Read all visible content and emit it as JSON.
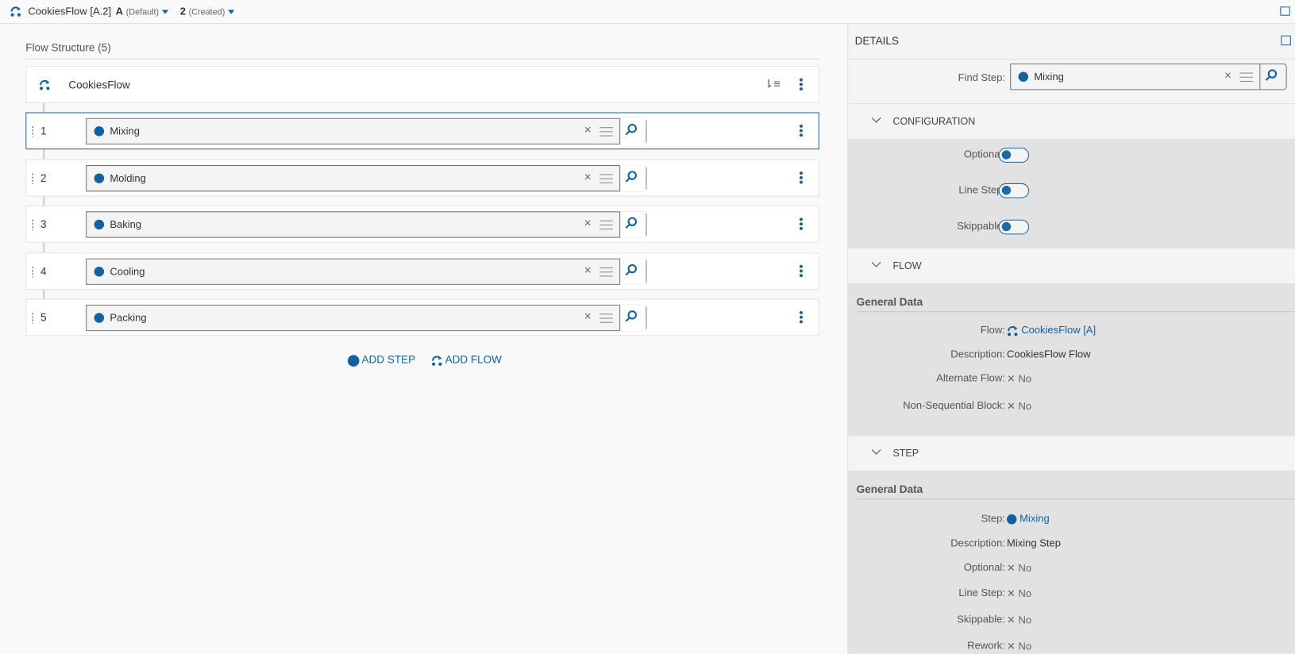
{
  "topbar": {
    "title": "CookiesFlow [A.2]",
    "version": "A",
    "version_note": "(Default)",
    "revision": "2",
    "revision_note": "(Created)"
  },
  "structure": {
    "title": "Flow Structure (5)",
    "root": "CookiesFlow",
    "steps": [
      {
        "num": "1",
        "name": "Mixing"
      },
      {
        "num": "2",
        "name": "Molding"
      },
      {
        "num": "3",
        "name": "Baking"
      },
      {
        "num": "4",
        "name": "Cooling"
      },
      {
        "num": "5",
        "name": "Packing"
      }
    ],
    "add_step": "ADD STEP",
    "add_flow": "ADD FLOW"
  },
  "details": {
    "title": "DETAILS",
    "find_label": "Find Step:",
    "find_value": "Mixing",
    "configuration": {
      "title": "CONFIGURATION",
      "optional": "Optional:",
      "line_step": "Line Step:",
      "skippable": "Skippable:"
    },
    "flow": {
      "title": "FLOW",
      "general": "General Data",
      "flow_label": "Flow:",
      "flow_value": "CookiesFlow [A]",
      "desc_label": "Description:",
      "desc_value": "CookiesFlow Flow",
      "alt_label": "Alternate Flow:",
      "alt_value": "No",
      "nsb_label": "Non-Sequential Block:",
      "nsb_value": "No"
    },
    "step": {
      "title": "STEP",
      "general": "General Data",
      "step_label": "Step:",
      "step_value": "Mixing",
      "desc_label": "Description:",
      "desc_value": "Mixing Step",
      "optional_label": "Optional:",
      "optional_value": "No",
      "line_label": "Line Step:",
      "line_value": "No",
      "skip_label": "Skippable:",
      "skip_value": "No",
      "rework_label": "Rework:",
      "rework_value": "No"
    }
  },
  "colors": {
    "accent": "#0f62a4"
  }
}
